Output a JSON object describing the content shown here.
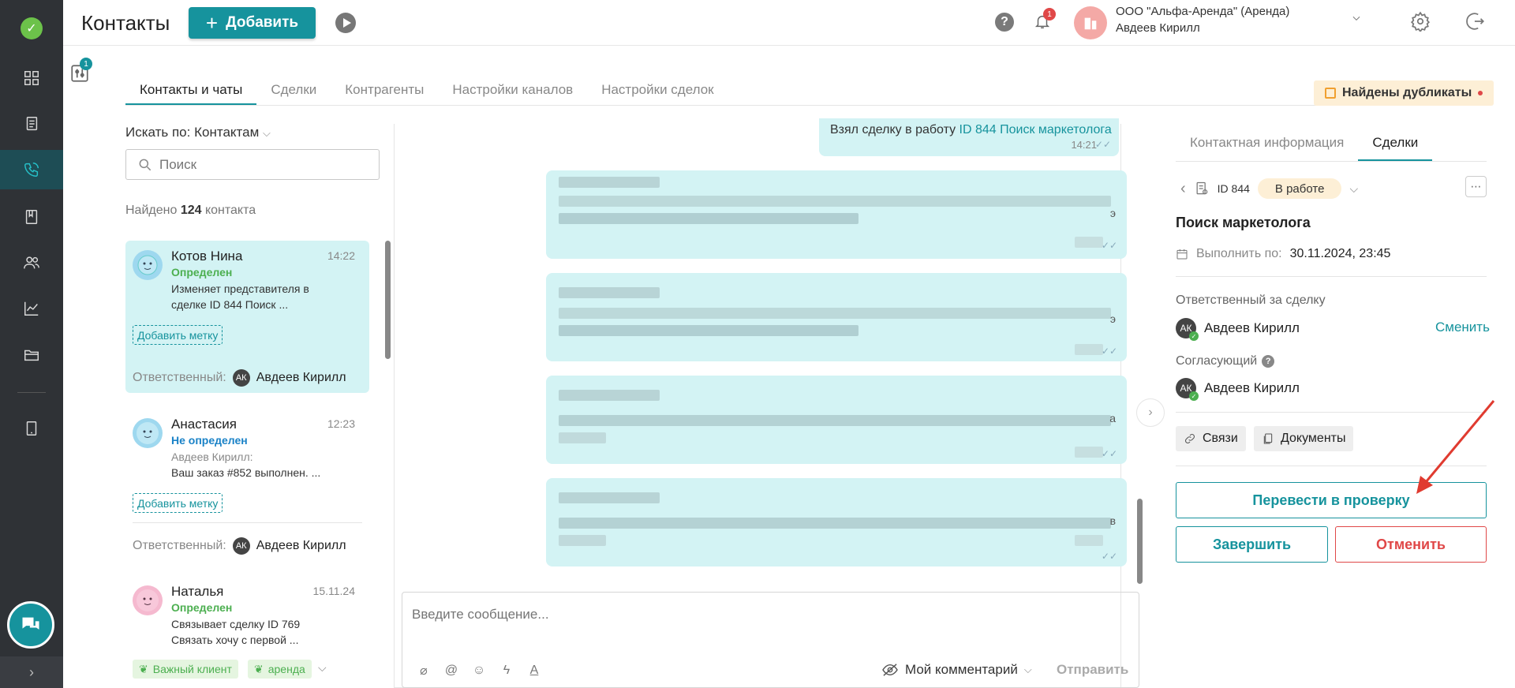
{
  "header": {
    "title": "Контакты",
    "add_button": "Добавить",
    "notification_count": "1",
    "org_name": "ООО \"Альфа-Аренда\" (Аренда)",
    "user_name": "Авдеев Кирилл"
  },
  "filter_badge": "1",
  "tabs": [
    {
      "label": "Контакты и чаты",
      "active": true
    },
    {
      "label": "Сделки",
      "active": false
    },
    {
      "label": "Контрагенты",
      "active": false
    },
    {
      "label": "Настройки каналов",
      "active": false
    },
    {
      "label": "Настройки сделок",
      "active": false
    }
  ],
  "duplicates_badge": "Найдены дубликаты",
  "contacts": {
    "search_by_label": "Искать по:",
    "search_by_value": "Контактам",
    "search_placeholder": "Поиск",
    "found_prefix": "Найдено",
    "found_count": "124",
    "found_suffix": "контакта",
    "items": [
      {
        "name": "Котов Нина",
        "time": "14:22",
        "status": "Определен",
        "text": "Изменяет представителя в сделке ID 844 Поиск ...",
        "tag_button": "Добавить метку",
        "resp_label": "Ответственный:",
        "resp_initials": "АК",
        "resp_name": "Авдеев Кирилл"
      },
      {
        "name": "Анастасия",
        "time": "12:23",
        "status": "Не определен",
        "author": "Авдеев Кирилл:",
        "text": "Ваш заказ #852 выполнен. ...",
        "tag_button": "Добавить метку",
        "resp_label": "Ответственный:",
        "resp_initials": "АК",
        "resp_name": "Авдеев Кирилл"
      },
      {
        "name": "Наталья",
        "time": "15.11.24",
        "status": "Определен",
        "text1": "Связывает сделку ID 769",
        "text2": "Связать хочу с первой ...",
        "tags": [
          "Важный клиент",
          "аренда"
        ]
      }
    ]
  },
  "chat": {
    "out_message_text": "Взял сделку в работу",
    "out_message_link": "ID 844 Поиск маркетолога",
    "out_message_time": "14:21",
    "bubble_tails": [
      "э",
      "э",
      "а",
      "в"
    ],
    "composer_placeholder": "Введите сообщение...",
    "comment_mode": "Мой комментарий",
    "send_button": "Отправить"
  },
  "deal_panel": {
    "tabs": [
      {
        "label": "Контактная информация",
        "active": false
      },
      {
        "label": "Сделки",
        "active": true
      }
    ],
    "deal_id": "ID 844",
    "deal_state": "В работе",
    "deal_title": "Поиск маркетолога",
    "due_label": "Выполнить по:",
    "due_value": "30.11.2024, 23:45",
    "responsible_label": "Ответственный за сделку",
    "responsible_initials": "АК",
    "responsible_name": "Авдеев Кирилл",
    "change_link": "Сменить",
    "approver_label": "Согласующий",
    "approver_initials": "АК",
    "approver_name": "Авдеев Кирилл",
    "links_button": "Связи",
    "docs_button": "Документы",
    "review_button": "Перевести в проверку",
    "complete_button": "Завершить",
    "cancel_button": "Отменить"
  },
  "colors": {
    "accent": "#16939d",
    "danger": "#e04848",
    "selected_card": "#d3f3f4",
    "nav_bg": "#2f3236",
    "arrow": "#e03b30"
  }
}
